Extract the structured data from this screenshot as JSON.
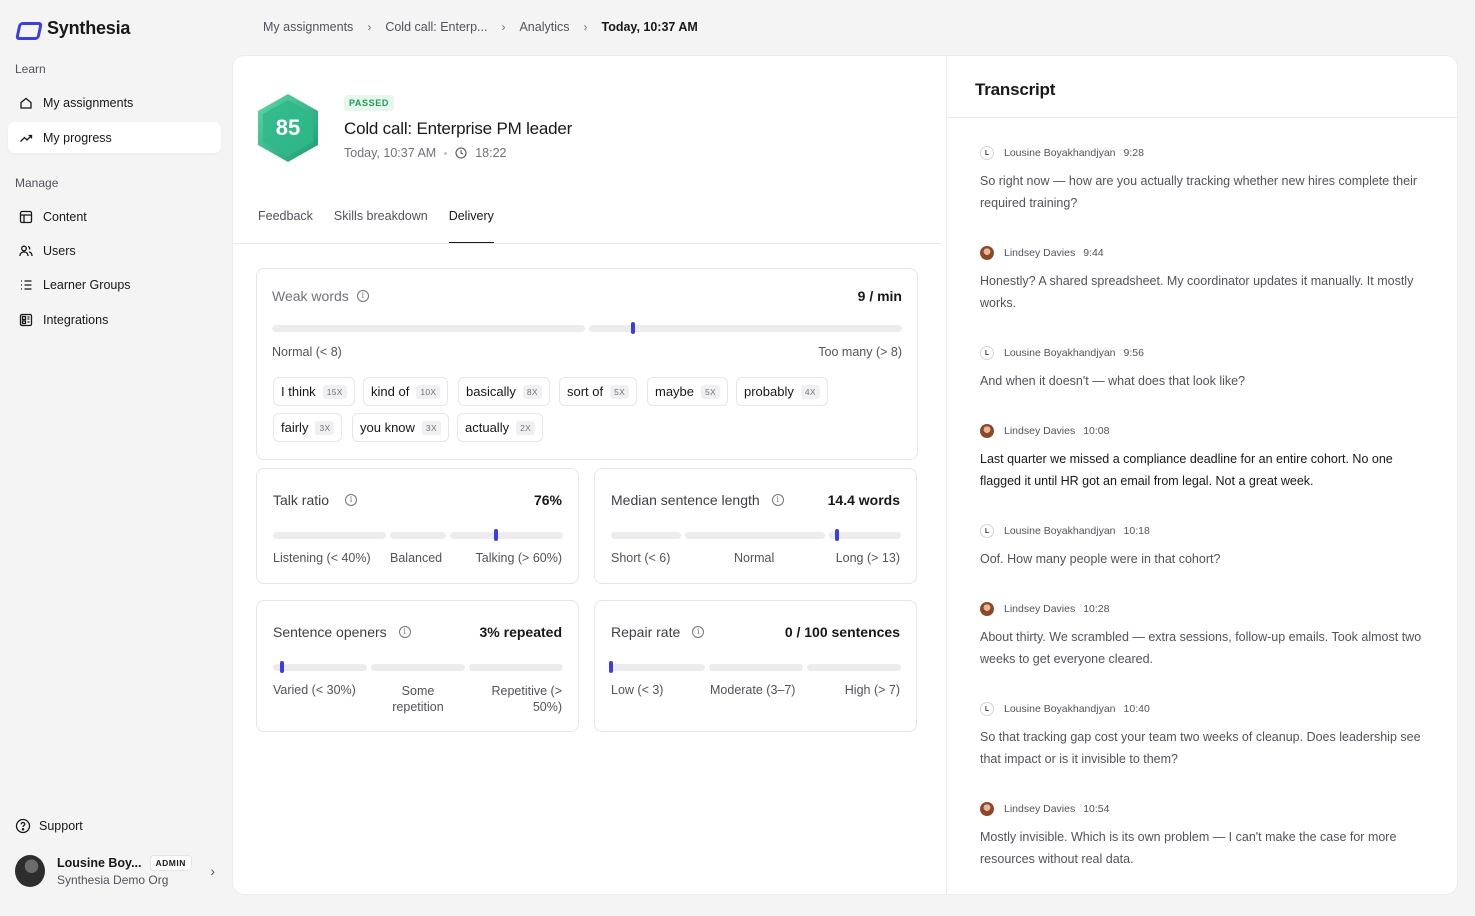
{
  "app": {
    "name": "Synthesia"
  },
  "sidebar": {
    "learn_label": "Learn",
    "manage_label": "Manage",
    "learn_items": [
      {
        "label": "My assignments",
        "icon": "home-icon"
      },
      {
        "label": "My progress",
        "icon": "trend-icon"
      }
    ],
    "manage_items": [
      {
        "label": "Content",
        "icon": "layout-icon"
      },
      {
        "label": "Users",
        "icon": "users-icon"
      },
      {
        "label": "Learner Groups",
        "icon": "list-icon"
      },
      {
        "label": "Integrations",
        "icon": "grid-icon"
      }
    ],
    "support_label": "Support",
    "user": {
      "name": "Lousine Boy...",
      "badge": "ADMIN",
      "org": "Synthesia Demo Org"
    }
  },
  "breadcrumb": [
    "My assignments",
    "Cold call: Enterp...",
    "Analytics",
    "Today, 10:37 AM"
  ],
  "header": {
    "score": "85",
    "status": "PASSED",
    "title": "Cold call: Enterprise PM leader",
    "date": "Today, 10:37 AM",
    "duration": "18:22"
  },
  "tabs": [
    "Feedback",
    "Skills breakdown",
    "Delivery"
  ],
  "active_tab": "Delivery",
  "metrics": {
    "weak_words": {
      "label": "Weak words",
      "value": "9 / min",
      "scale_low": "Normal (< 8)",
      "scale_high": "Too many (> 8)",
      "chips": [
        {
          "word": "I think",
          "count": "15X"
        },
        {
          "word": "kind of",
          "count": "10X"
        },
        {
          "word": "basically",
          "count": "8X"
        },
        {
          "word": "sort of",
          "count": "5X"
        },
        {
          "word": "maybe",
          "count": "5X"
        },
        {
          "word": "probably",
          "count": "4X"
        },
        {
          "word": "fairly",
          "count": "3X"
        },
        {
          "word": "you know",
          "count": "3X"
        },
        {
          "word": "actually",
          "count": "2X"
        }
      ]
    },
    "talk_ratio": {
      "label": "Talk ratio",
      "value": "76%",
      "scale": [
        "Listening (< 40%)",
        "Balanced",
        "Talking (> 60%)"
      ]
    },
    "median_sentence": {
      "label": "Median sentence length",
      "value": "14.4 words",
      "scale": [
        "Short (< 6)",
        "Normal",
        "Long (> 13)"
      ]
    },
    "sentence_openers": {
      "label": "Sentence openers",
      "value": "3% repeated",
      "scale": [
        "Varied (< 30%)",
        "Some repetition",
        "Repetitive (> 50%)"
      ]
    },
    "repair_rate": {
      "label": "Repair rate",
      "value": "0 / 100 sentences",
      "scale": [
        "Low (< 3)",
        "Moderate (3–7)",
        "High (> 7)"
      ]
    }
  },
  "transcript": {
    "title": "Transcript",
    "entries": [
      {
        "speaker": "Lousine Boyakhandjyan",
        "initial": "L",
        "time": "9:28",
        "text": "So right now — how are you actually tracking whether new hires complete their required training?"
      },
      {
        "speaker": "Lindsey Davies",
        "initial": "",
        "time": "9:44",
        "text": "Honestly? A shared spreadsheet. My coordinator updates it manually. It mostly works."
      },
      {
        "speaker": "Lousine Boyakhandjyan",
        "initial": "L",
        "time": "9:56",
        "text": "And when it doesn't — what does that look like?"
      },
      {
        "speaker": "Lindsey Davies",
        "initial": "",
        "time": "10:08",
        "text": "Last quarter we missed a compliance deadline for an entire cohort. No one flagged it until HR got an email from legal. Not a great week."
      },
      {
        "speaker": "Lousine Boyakhandjyan",
        "initial": "L",
        "time": "10:18",
        "text": "Oof. How many people were in that cohort?"
      },
      {
        "speaker": "Lindsey Davies",
        "initial": "",
        "time": "10:28",
        "text": "About thirty. We scrambled — extra sessions, follow-up emails. Took almost two weeks to get everyone cleared."
      },
      {
        "speaker": "Lousine Boyakhandjyan",
        "initial": "L",
        "time": "10:40",
        "text": "So that tracking gap cost your team two weeks of cleanup. Does leadership see that impact or is it invisible to them?"
      },
      {
        "speaker": "Lindsey Davies",
        "initial": "",
        "time": "10:54",
        "text": "Mostly invisible. Which is its own problem — I can't make the case for more resources without real data."
      }
    ]
  },
  "colors": {
    "accent": "#3b3fe0",
    "score_green": "#2fb889",
    "passed_green": "#1f9d55"
  }
}
